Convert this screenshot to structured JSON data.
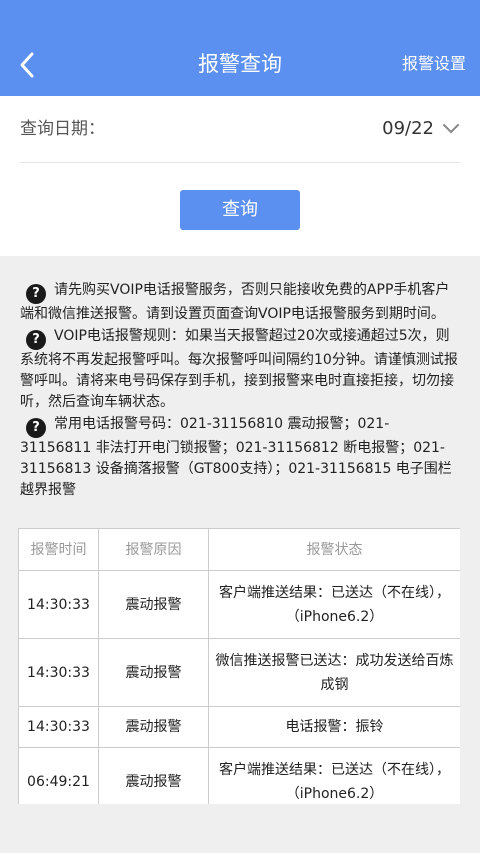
{
  "header": {
    "title": "报警查询",
    "settings_label": "报警设置"
  },
  "query": {
    "date_label": "查询日期：",
    "date_value": "09/22",
    "button_label": "查询"
  },
  "notes": [
    "请先购买VOIP电话报警服务，否则只能接收免费的APP手机客户端和微信推送报警。请到设置页面查询VOIP电话报警服务到期时间。",
    "VOIP电话报警规则：如果当天报警超过20次或接通超过5次，则系统将不再发起报警呼叫。每次报警呼叫间隔约10分钟。请谨慎测试报警呼叫。请将来电号码保存到手机，接到报警来电时直接拒接，切勿接听，然后查询车辆状态。",
    "常用电话报警号码：021-31156810 震动报警；021-31156811 非法打开电门锁报警；021-31156812 断电报警；021-31156813 设备摘落报警（GT800支持）；021-31156815 电子围栏越界报警"
  ],
  "table": {
    "headers": [
      "报警时间",
      "报警原因",
      "报警状态"
    ],
    "rows": [
      {
        "time": "14:30:33",
        "reason": "震动报警",
        "status": "客户端推送结果：已送达（不在线），（iPhone6.2）"
      },
      {
        "time": "14:30:33",
        "reason": "震动报警",
        "status": "微信推送报警已送达：成功发送给百炼成钢"
      },
      {
        "time": "14:30:33",
        "reason": "震动报警",
        "status": "电话报警：振铃"
      },
      {
        "time": "06:49:21",
        "reason": "震动报警",
        "status": "客户端推送结果：已送达（不在线），（iPhone6.2）"
      }
    ]
  },
  "colors": {
    "primary": "#5b8ff0",
    "background": "#efefef"
  }
}
